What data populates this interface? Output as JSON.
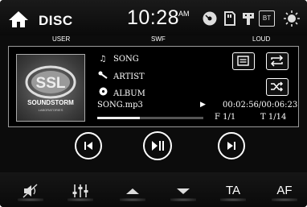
{
  "header": {
    "source": "DISC",
    "time": "10:28",
    "ampm": "AM",
    "icons": [
      "home-icon",
      "disc-icon",
      "sd-card-icon",
      "usb-icon",
      "bt-icon",
      "brightness-icon"
    ],
    "bt_label": "BT"
  },
  "modes": {
    "left": "USER",
    "center": "SWF",
    "right": "LOUD"
  },
  "track": {
    "song": "SONG",
    "artist": "ARTIST",
    "album": "ALBUM",
    "file": "SONG.mp3",
    "play_state_icon": "play-small-icon",
    "time": "00:02:56/00:06:23",
    "folder": "F  1/1",
    "track_no": "T  1/14",
    "progress": 0.4
  },
  "cover_text": {
    "logo": "SSL",
    "brand": "SOUNDSTORM",
    "sub": "LABORATORIES"
  },
  "controls": [
    "previous-button",
    "play-pause-button",
    "next-button"
  ],
  "bottom": {
    "items": [
      "mute-icon",
      "equalizer-icon",
      "volume-up-icon",
      "volume-down-icon",
      "TA",
      "AF"
    ],
    "ta_label": "TA",
    "af_label": "AF"
  },
  "colors": {
    "background": "#0c0c0c",
    "foreground": "#ffffff",
    "border": "#9a9a9a"
  }
}
